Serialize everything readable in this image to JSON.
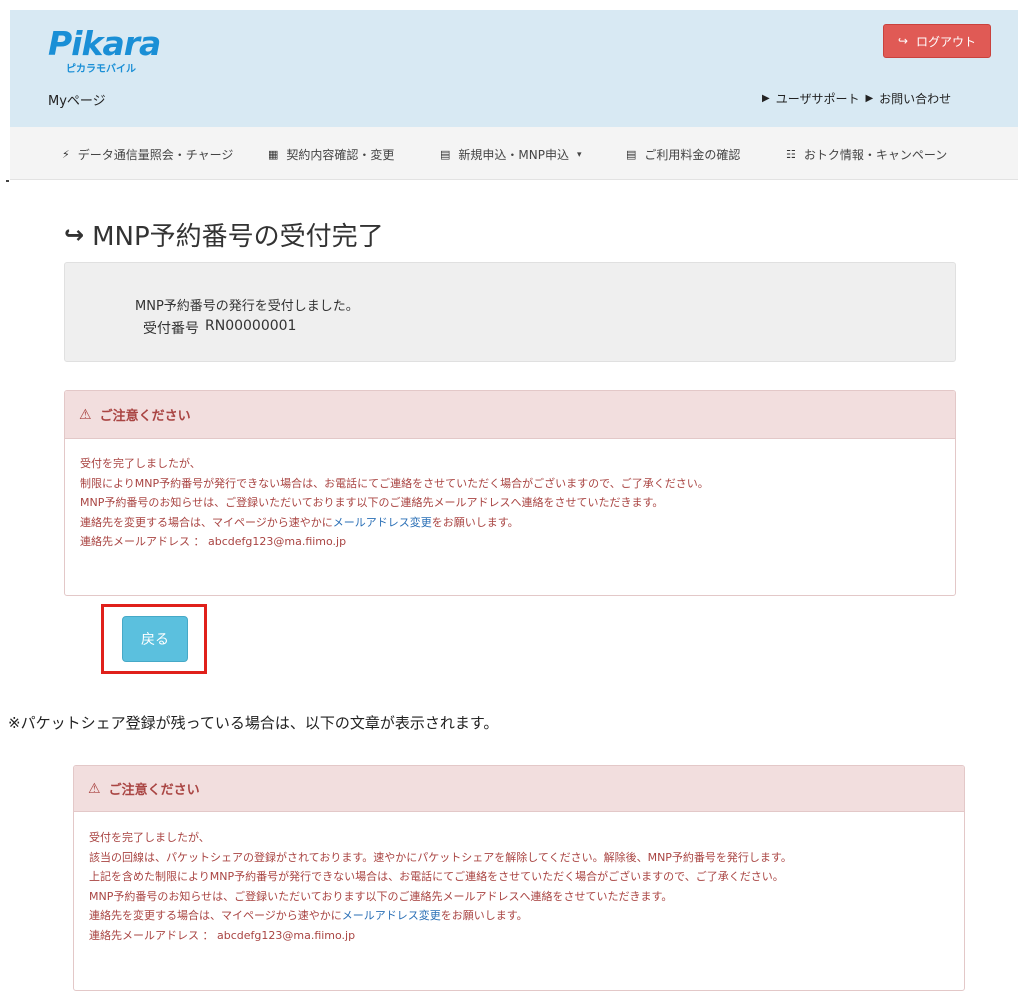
{
  "header": {
    "logo_main": "Pikara",
    "logo_sub": "ピカラモバイル",
    "mypage": "Myページ",
    "logout": "ログアウト",
    "support": "ユーザサポート",
    "contact": "お問い合わせ"
  },
  "nav": {
    "items": [
      {
        "label": "データ通信量照会・チャージ",
        "icon": "bolt-icon"
      },
      {
        "label": "契約内容確認・変更",
        "icon": "grid-icon"
      },
      {
        "label": "新規申込・MNP申込",
        "icon": "book-icon"
      },
      {
        "label": "ご利用料金の確認",
        "icon": "list-icon"
      },
      {
        "label": "おトク情報・キャンペーン",
        "icon": "gift-icon"
      }
    ]
  },
  "page": {
    "title": "MNP予約番号の受付完了"
  },
  "receipt": {
    "message": "MNP予約番号の発行を受付しました。",
    "number_label": "受付番号",
    "number": "RN00000001"
  },
  "alert1": {
    "title": "ご注意ください",
    "line1": "受付を完了しましたが、",
    "line2": "制限によりMNP予約番号が発行できない場合は、お電話にてご連絡をさせていただく場合がございますので、ご了承ください。",
    "line3": "MNP予約番号のお知らせは、ご登録いただいております以下のご連絡先メールアドレスへ連絡をさせていただきます。",
    "line4_pre": "連絡先を変更する場合は、マイページから速やかに",
    "line4_link": "メールアドレス変更",
    "line4_post": "をお願いします。",
    "line5": "連絡先メールアドレス ： abcdefg123@ma.fiimo.jp"
  },
  "back_button": "戻る",
  "note": "※パケットシェア登録が残っている場合は、以下の文章が表示されます。",
  "alert2": {
    "title": "ご注意ください",
    "line1": "受付を完了しましたが、",
    "line2": "該当の回線は、パケットシェアの登録がされております。速やかにパケットシェアを解除してください。解除後、MNP予約番号を発行します。",
    "line3": "上記を含めた制限によりMNP予約番号が発行できない場合は、お電話にてご連絡をさせていただく場合がございますので、ご了承ください。",
    "line4": "MNP予約番号のお知らせは、ご登録いただいております以下のご連絡先メールアドレスへ連絡をさせていただきます。",
    "line5_pre": "連絡先を変更する場合は、マイページから速やかに",
    "line5_link": "メールアドレス変更",
    "line5_post": "をお願いします。",
    "line6": "連絡先メールアドレス ： abcdefg123@ma.fiimo.jp"
  }
}
